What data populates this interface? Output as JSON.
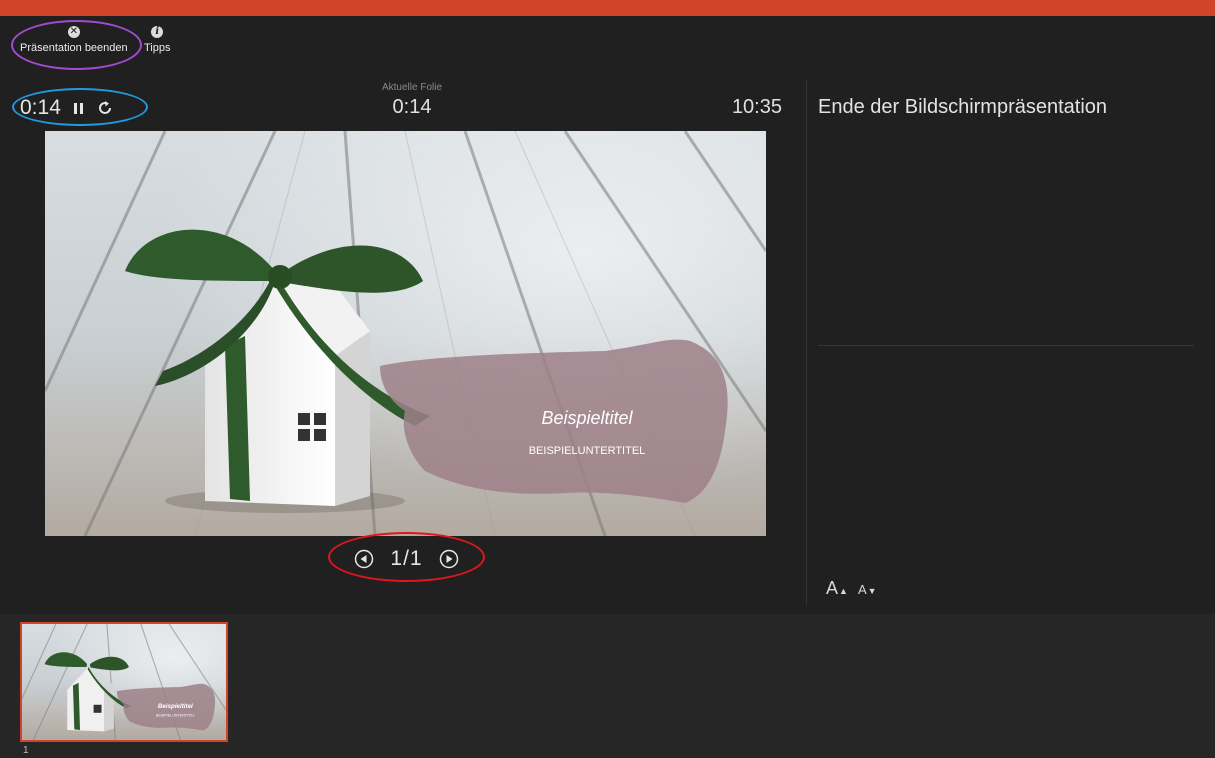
{
  "colors": {
    "accent": "#d2442a",
    "background": "#202020",
    "annotation_purple": "#a24bd1",
    "annotation_blue": "#1f9be0",
    "annotation_red": "#e0161b",
    "slide_brush": "#9e8088",
    "ribbon": "#2f5a2c"
  },
  "toolbar": {
    "end_label": "Präsentation beenden",
    "end_icon": "close-circle-icon",
    "tips_label": "Tipps",
    "tips_icon": "info-icon"
  },
  "timer": {
    "elapsed": "0:14",
    "pause_icon": "pause-icon",
    "reset_icon": "reset-icon"
  },
  "current_slide": {
    "label": "Aktuelle Folie",
    "time": "0:14"
  },
  "clock": "10:35",
  "slide": {
    "title": "Beispieltitel",
    "subtitle": "BEISPIELUNTERTITEL"
  },
  "navigation": {
    "counter": "1/1",
    "prev_icon": "previous-icon",
    "next_icon": "next-icon"
  },
  "notes": {
    "text": "Ende der Bildschirmpräsentation"
  },
  "font_controls": {
    "increase_label": "A",
    "decrease_label": "A",
    "increase_sup": "▲",
    "decrease_sup": "▼"
  },
  "filmstrip": {
    "thumbnails": [
      {
        "number": "1",
        "title": "Beispieltitel",
        "subtitle": "BEISPIELUNTERTITEL"
      }
    ]
  }
}
